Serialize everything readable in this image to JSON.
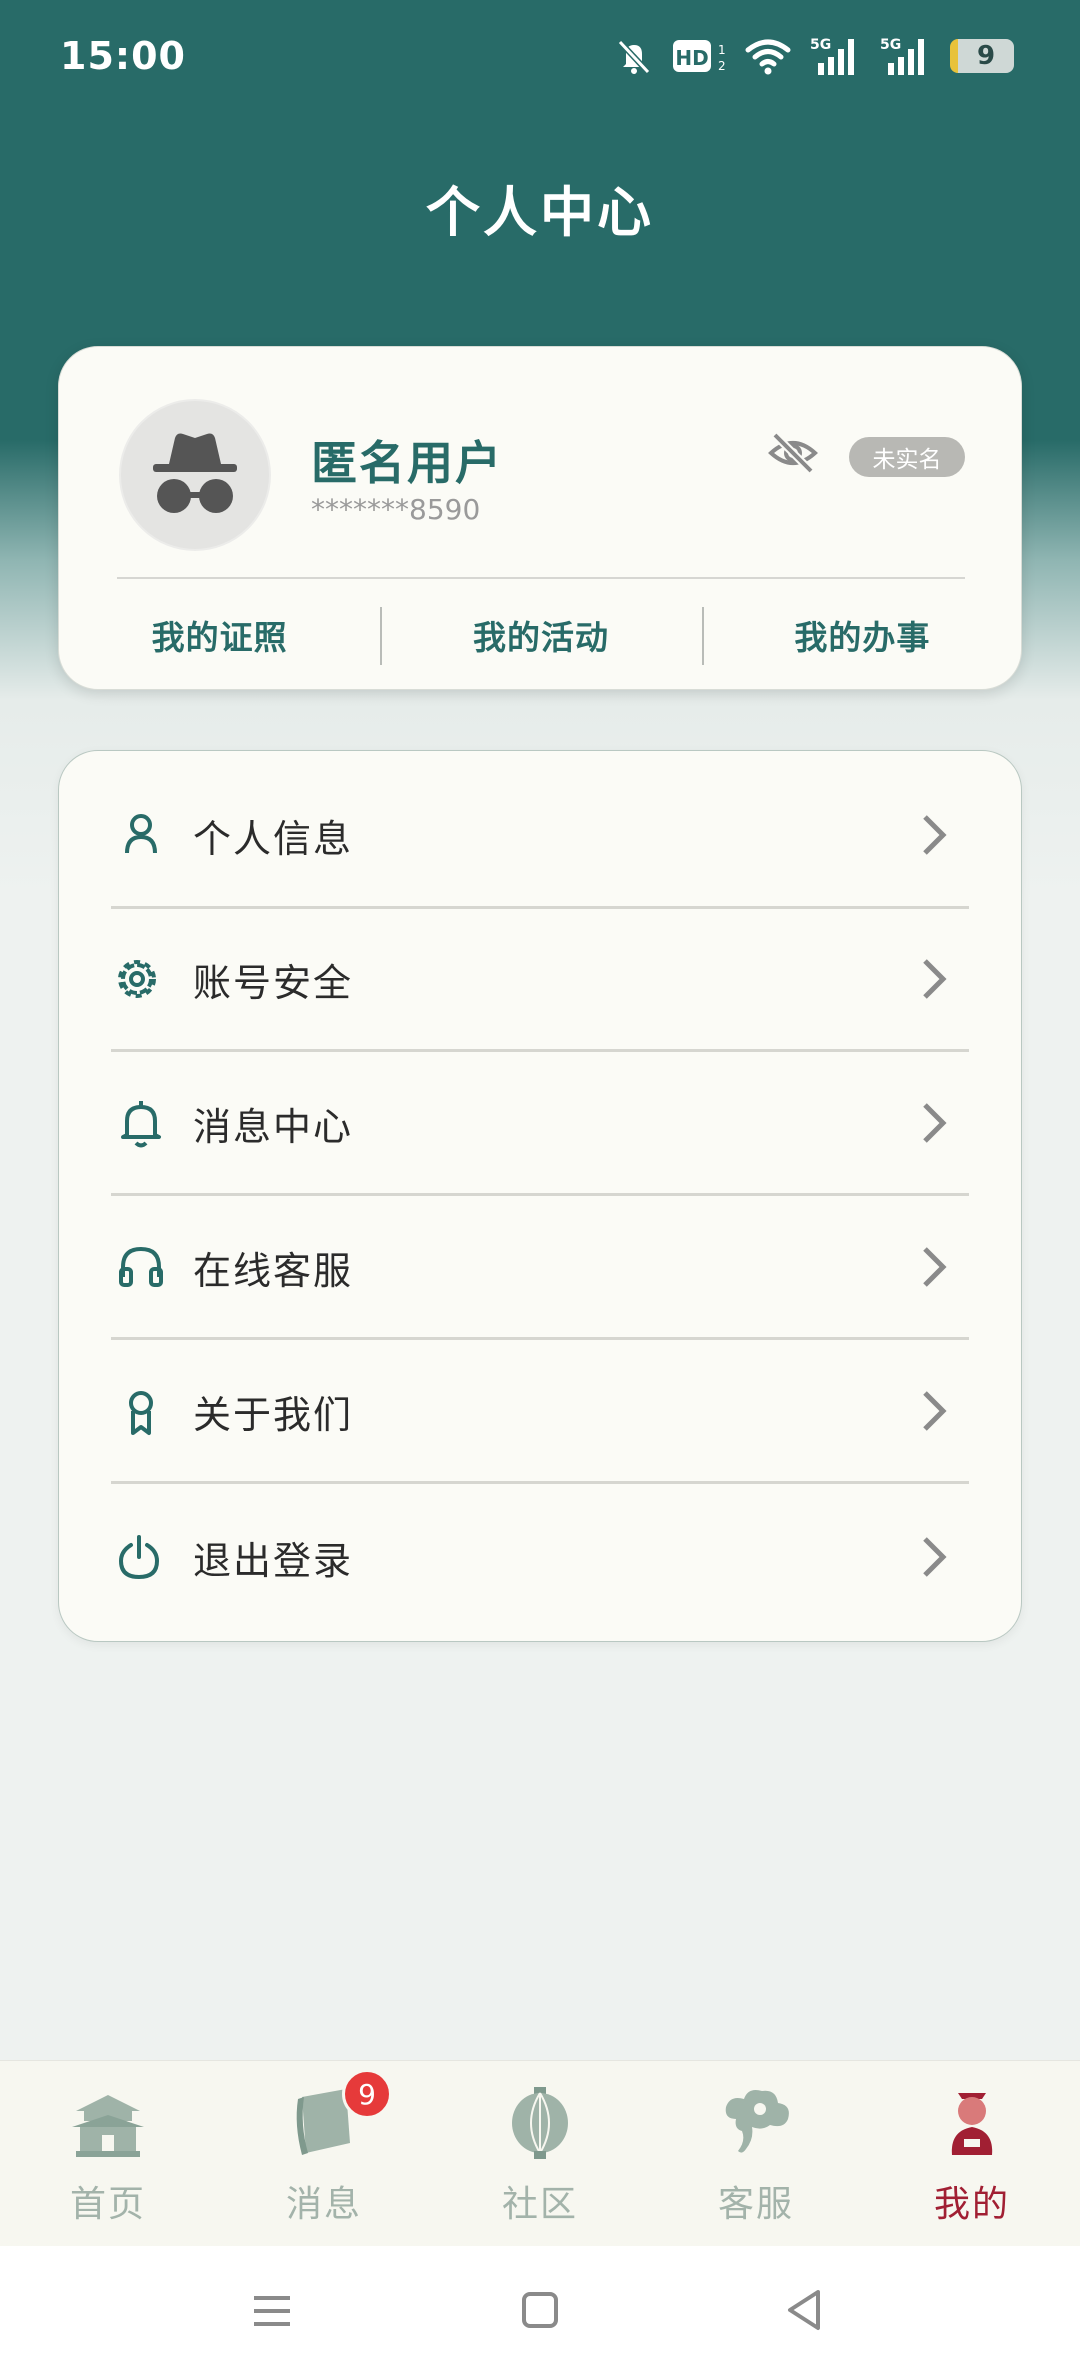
{
  "status_bar": {
    "time": "15:00",
    "battery": "9",
    "icons": [
      "mute-bell-icon",
      "hd-icon",
      "wifi-icon",
      "signal-5g-icon",
      "signal-5g-icon",
      "battery-icon"
    ]
  },
  "header": {
    "title": "个人中心"
  },
  "profile": {
    "name": "匿名用户",
    "phone": "*******8590",
    "verify_badge": "未实名",
    "quick_links": [
      "我的证照",
      "我的活动",
      "我的办事"
    ]
  },
  "menu": [
    {
      "label": "个人信息",
      "icon": "person-icon"
    },
    {
      "label": "账号安全",
      "icon": "gear-icon"
    },
    {
      "label": "消息中心",
      "icon": "bell-icon"
    },
    {
      "label": "在线客服",
      "icon": "headset-icon"
    },
    {
      "label": "关于我们",
      "icon": "ribbon-icon"
    },
    {
      "label": "退出登录",
      "icon": "power-icon"
    }
  ],
  "bottom_nav": {
    "items": [
      {
        "label": "首页",
        "icon": "palace-icon"
      },
      {
        "label": "消息",
        "icon": "scroll-icon",
        "badge": "9"
      },
      {
        "label": "社区",
        "icon": "lantern-icon"
      },
      {
        "label": "客服",
        "icon": "cloud-icon"
      },
      {
        "label": "我的",
        "icon": "figure-icon"
      }
    ],
    "active_index": 4
  },
  "colors": {
    "primary": "#286b68",
    "active_tab": "#a11f33",
    "badge": "#e63a3a"
  }
}
